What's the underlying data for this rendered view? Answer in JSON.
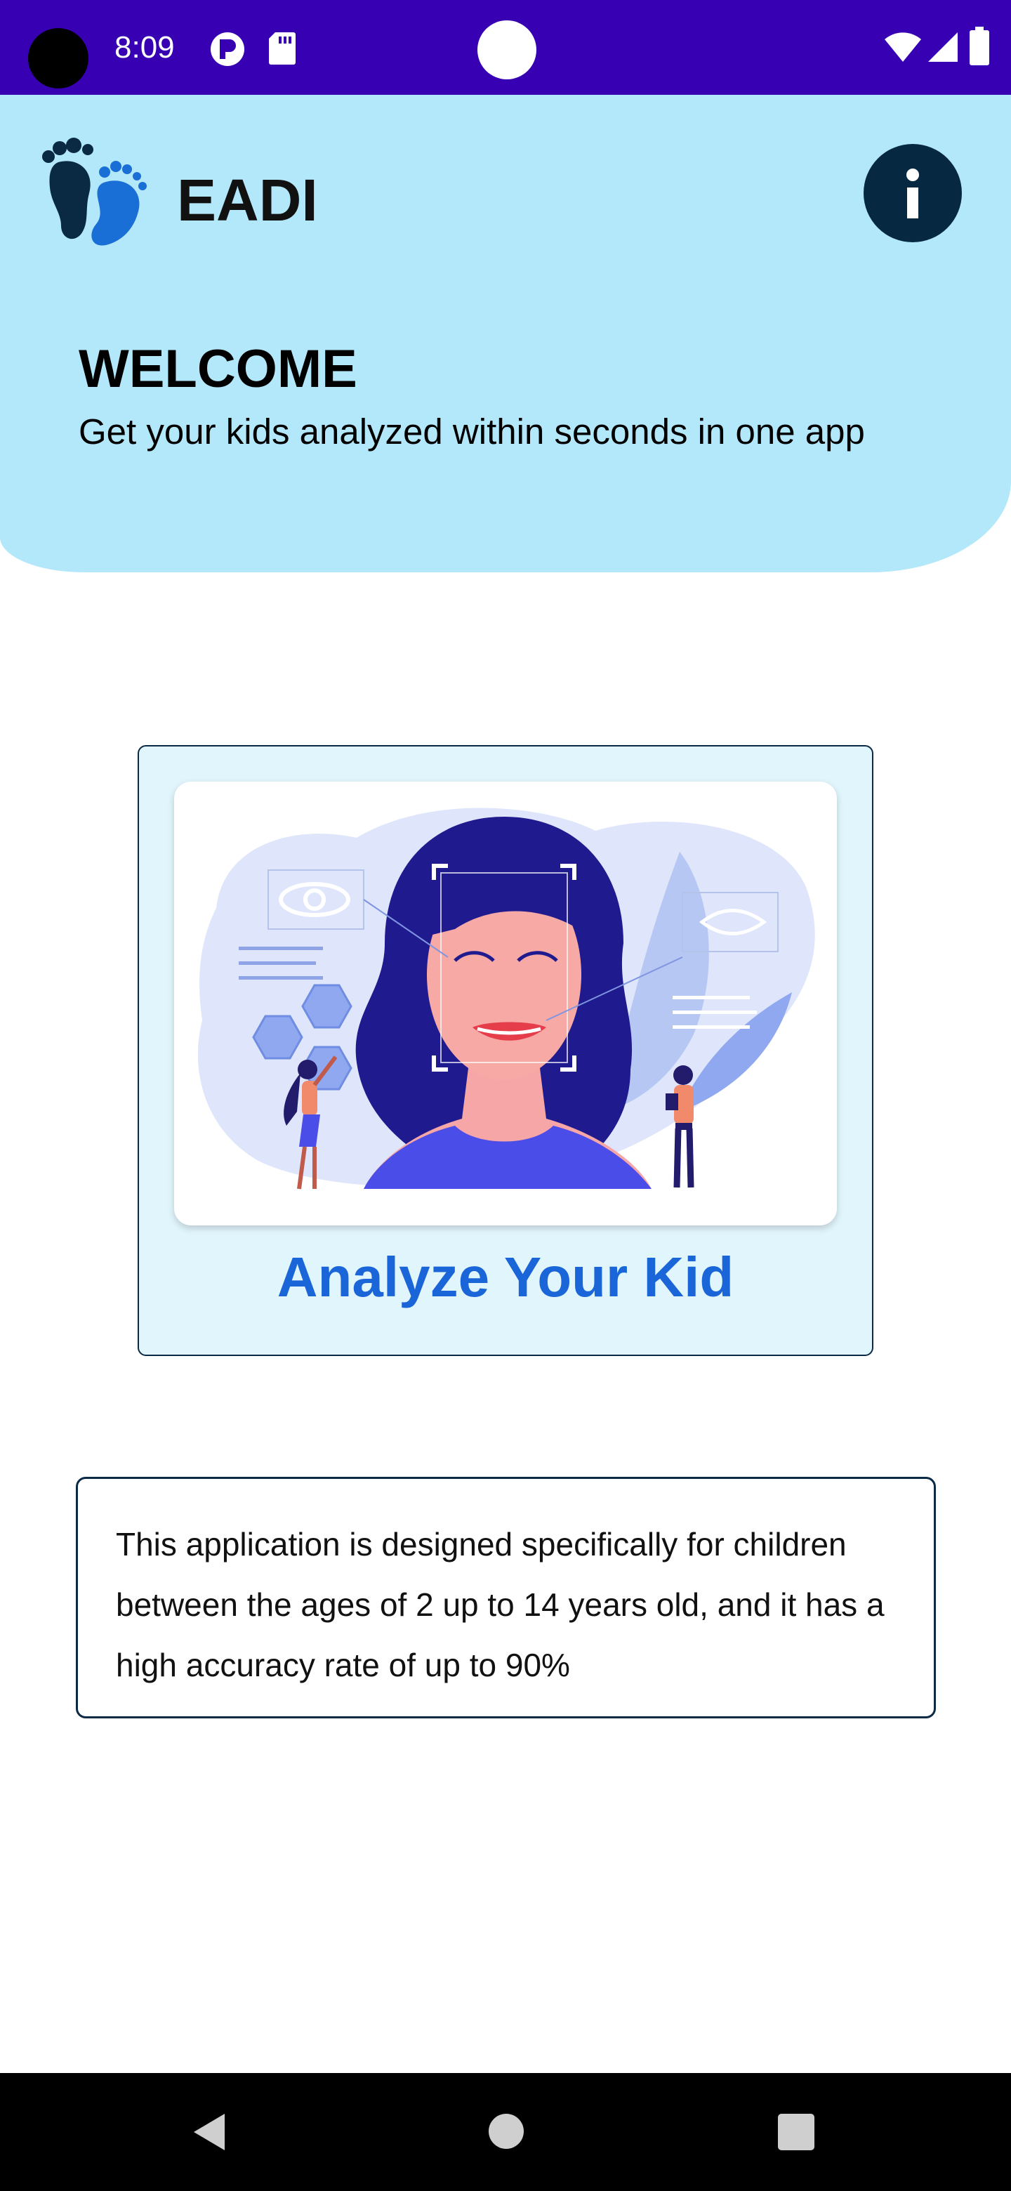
{
  "status_bar": {
    "time": "8:09",
    "icons": [
      "privacy-indicator-icon",
      "sd-card-icon",
      "wifi-icon",
      "cellular-signal-icon",
      "battery-icon"
    ]
  },
  "header": {
    "app_name": "EADI",
    "logo_icon": "baby-footprints-icon",
    "info_icon": "info-icon",
    "welcome_title": "WELCOME",
    "welcome_subtitle": "Get your kids analyzed within seconds in one app"
  },
  "analyze_card": {
    "label": "Analyze Your Kid",
    "illustration": "face-recognition-illustration"
  },
  "info_box": {
    "text": "This application is designed specifically for children between the ages of 2 up to 14 years old, and it has a high accuracy rate of up to 90%"
  },
  "nav_bar": {
    "items": [
      "back-icon",
      "home-icon",
      "recents-icon"
    ]
  },
  "colors": {
    "status_bar": "#3700b3",
    "header_bg": "#b3e7fa",
    "card_bg": "#e1f5fc",
    "accent_text": "#1a65d8",
    "dark_navy": "#062840"
  }
}
